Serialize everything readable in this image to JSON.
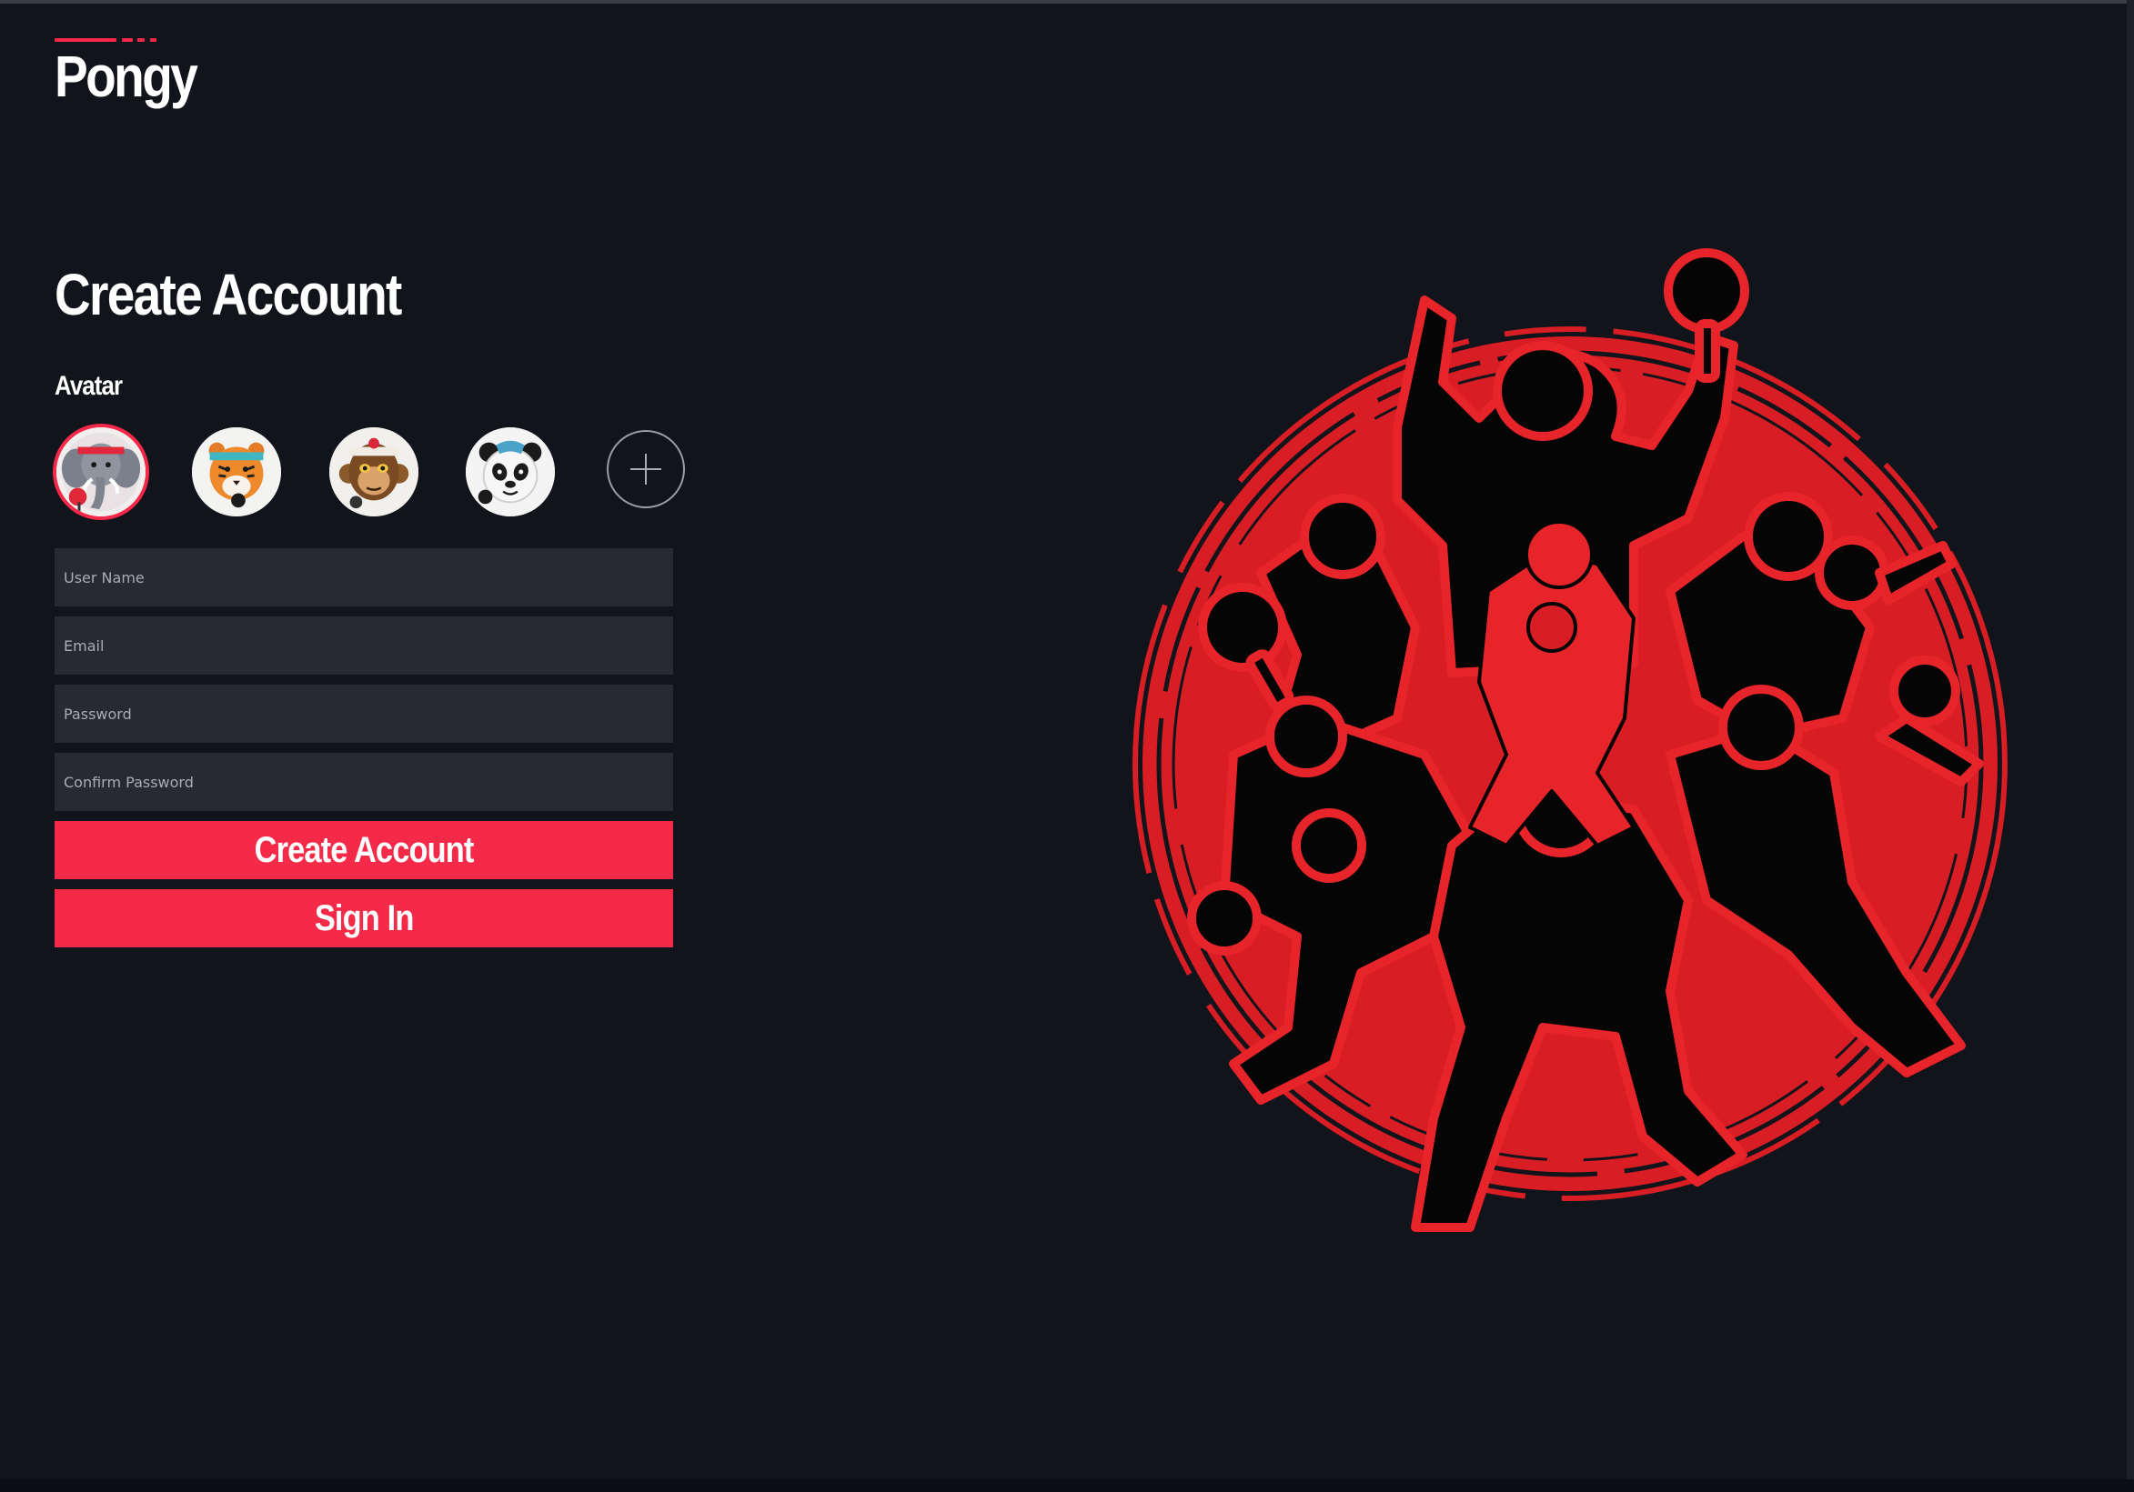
{
  "app": {
    "name": "Pongy",
    "brand_color": "#f5284a",
    "background_color": "#12141b"
  },
  "form": {
    "title": "Create Account",
    "avatar_label": "Avatar",
    "avatars": [
      {
        "name": "elephant-avatar",
        "selected": true
      },
      {
        "name": "tiger-avatar",
        "selected": false
      },
      {
        "name": "monkey-avatar",
        "selected": false
      },
      {
        "name": "panda-avatar",
        "selected": false
      }
    ],
    "add_avatar_icon": "plus-icon",
    "fields": {
      "username": {
        "placeholder": "User Name",
        "value": ""
      },
      "email": {
        "placeholder": "Email",
        "value": ""
      },
      "password": {
        "placeholder": "Password",
        "value": ""
      },
      "confirm_password": {
        "placeholder": "Confirm Password",
        "value": ""
      }
    },
    "create_button": "Create Account",
    "signin_button": "Sign In"
  },
  "hero": {
    "image": "table-tennis-players-silhouette-illustration",
    "circle_color": "#d81e24",
    "outline_color": "#e8242b"
  }
}
